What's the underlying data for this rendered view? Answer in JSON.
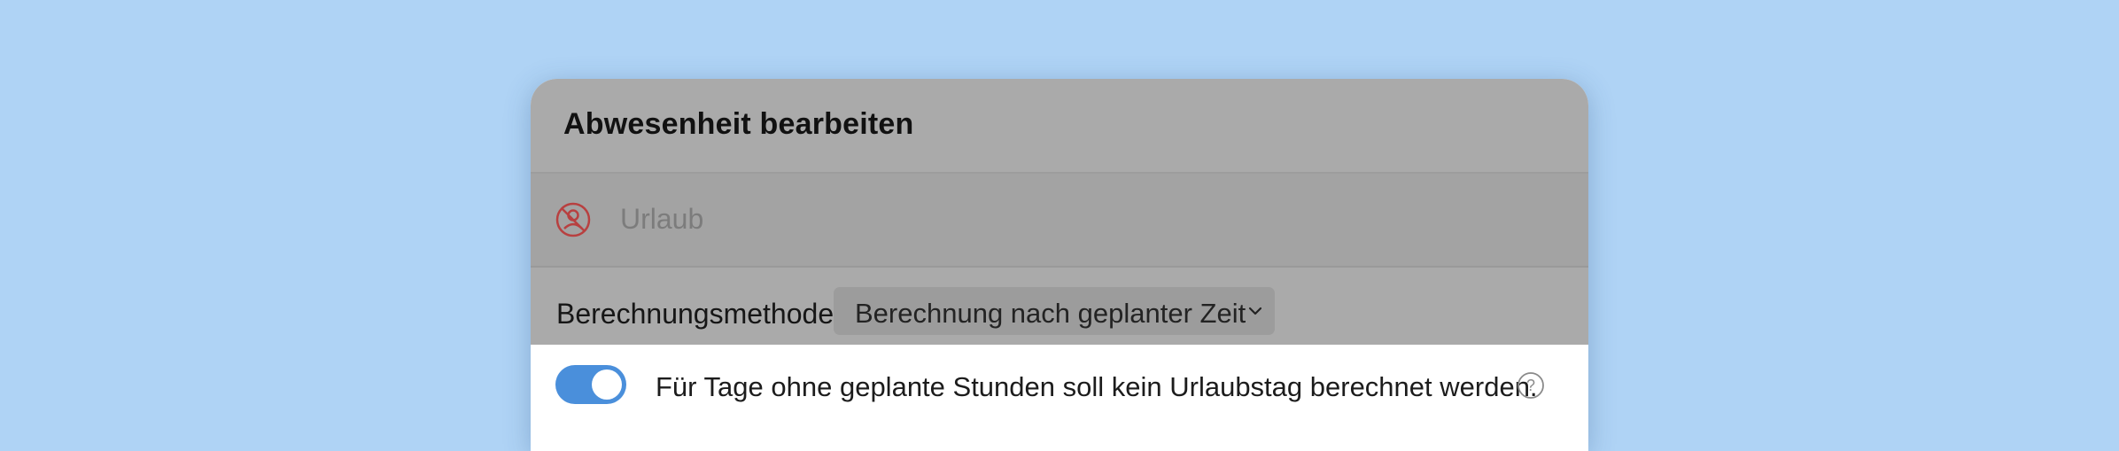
{
  "dialog": {
    "title": "Abwesenheit bearbeiten"
  },
  "absence_type": {
    "label": "Urlaub",
    "icon": "person-crossed-icon",
    "icon_color": "#b84040"
  },
  "calculation": {
    "label": "Berechnungsmethode",
    "selected_value": "Berechnung nach geplanter Zeit"
  },
  "no_planned_hours_toggle": {
    "label": "Für Tage ohne geplante Stunden soll kein Urlaubstag berechnet werden.",
    "checked": true,
    "accent_color": "#4a8fdb"
  },
  "help": {
    "icon": "help-icon"
  }
}
